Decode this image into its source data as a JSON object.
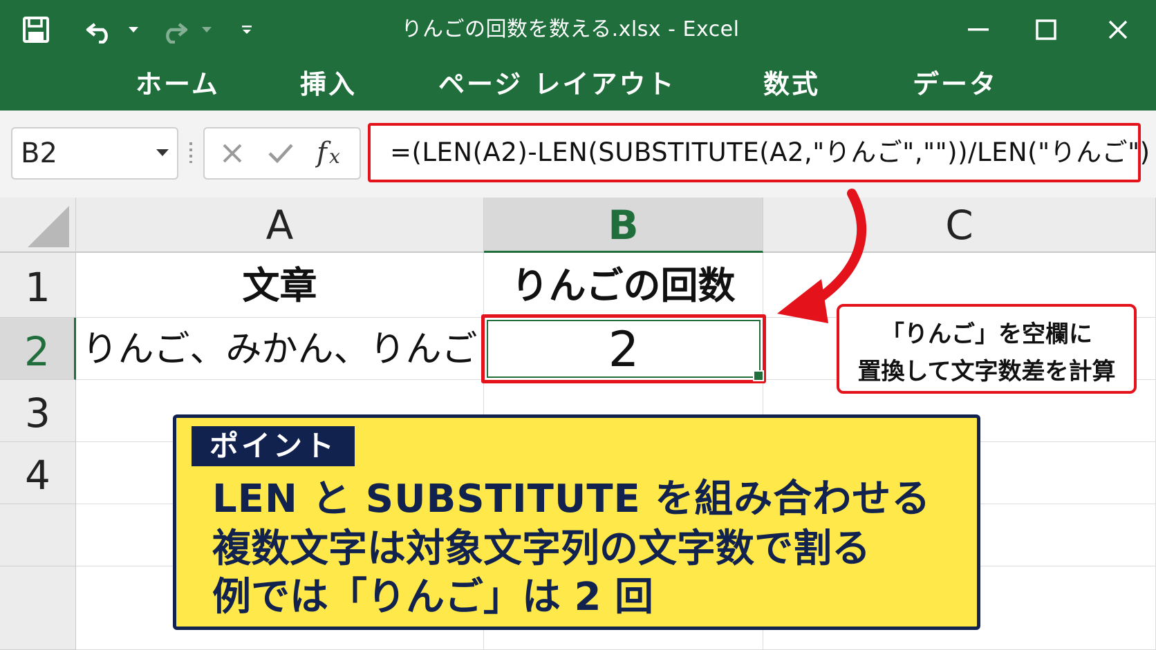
{
  "titlebar": {
    "title": "りんごの回数を数える.xlsx - Excel",
    "icons": [
      "save-icon",
      "undo-icon",
      "dropdown-icon",
      "redo-icon",
      "dropdown-icon",
      "customize-quick-access-icon",
      "minimize-icon",
      "maximize-icon",
      "close-icon"
    ],
    "color": "#1f6e3c"
  },
  "ribbon": {
    "tabs": [
      "ホーム",
      "挿入",
      "ページ レイアウト",
      "数式",
      "データ"
    ]
  },
  "formula_bar": {
    "name_box": "B2",
    "formula": "=(LEN(A2)-LEN(SUBSTITUTE(A2,\"りんご\",\"\"))/LEN(\"りんご\")",
    "icons": [
      "cancel-icon",
      "enter-icon",
      "fx-icon"
    ]
  },
  "sheet": {
    "columns": [
      "A",
      "B",
      "C"
    ],
    "rows": [
      "1",
      "2",
      "3",
      "4"
    ],
    "A1": "文章",
    "B1": "りんごの回数",
    "A2": "りんご、みかん、りんご",
    "B2": "2",
    "selected_cell": "B2"
  },
  "callout": {
    "line1": "「りんご」を空欄に",
    "line2": "置換して文字数差を計算",
    "border_color": "#e3121b"
  },
  "point": {
    "tag": "ポイント",
    "line1": "LEN と SUBSTITUTE を組み合わせる",
    "line2": "複数文字は対象文字列の文字数で割る",
    "line3": "例では「りんご」は 2 回",
    "background": "#ffe94a",
    "text_color": "#12224f"
  }
}
